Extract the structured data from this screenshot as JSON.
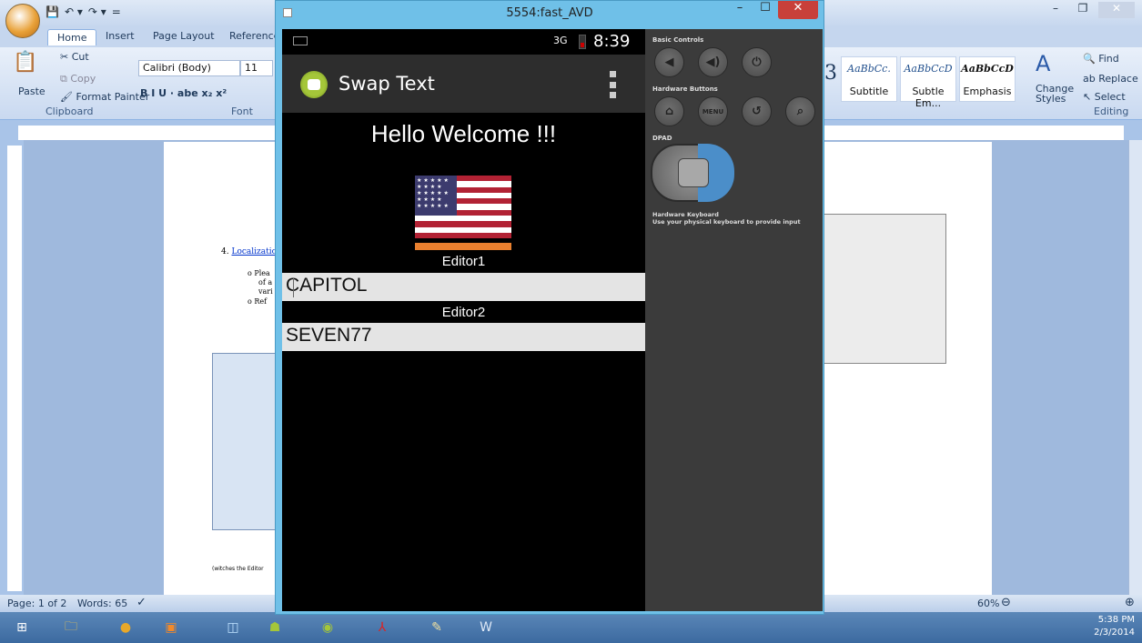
{
  "word": {
    "qat": [
      "💾",
      "↶ ▾",
      "↷ ▾",
      "="
    ],
    "tabs": [
      "Home",
      "Insert",
      "Page Layout",
      "References"
    ],
    "clipboard": {
      "cut": "Cut",
      "copy": "Copy",
      "paste": "Paste",
      "format_painter": "Format Painter",
      "label": "Clipboard"
    },
    "font": {
      "name": "Calibri (Body)",
      "size": "11",
      "label": "Font",
      "toolbar": "B  I  U  · abe  x₂  x²"
    },
    "styles": [
      {
        "sample": "AaBbCc.",
        "name": "Subtitle"
      },
      {
        "sample": "AaBbCcD",
        "name": "Subtle Em..."
      },
      {
        "sample": "AaBbCcD",
        "name": "Emphasis"
      }
    ],
    "change_styles": "Change Styles",
    "editing": {
      "find": "Find",
      "replace": "Replace",
      "select": "Select",
      "label": "Editing"
    },
    "doc": {
      "list_number": "4.",
      "list_link": "Localizatic",
      "lines": [
        "o  Plea",
        "of a",
        "vari",
        "o  Ref"
      ],
      "caption": "(witches the Editor"
    },
    "status": {
      "page": "Page: 1 of 2",
      "words": "Words: 65",
      "zoom": "60%"
    },
    "clock": {
      "time": "5:38 PM",
      "date": "2/3/2014"
    }
  },
  "avd": {
    "window_title": "5554:fast_AVD",
    "status_time": "8:39",
    "status_network": "3G",
    "app_title": "Swap Text",
    "welcome": "Hello Welcome !!!",
    "editor1_label": "Editor1",
    "editor1_value": "CAPITOL",
    "editor2_label": "Editor2",
    "editor2_value": "SEVEN77"
  },
  "controls": {
    "basic": "Basic Controls",
    "hardware": "Hardware Buttons",
    "dpad": "DPAD",
    "keyboard_title": "Hardware Keyboard",
    "keyboard_hint": "Use your physical keyboard to provide input",
    "menu": "MENU"
  }
}
